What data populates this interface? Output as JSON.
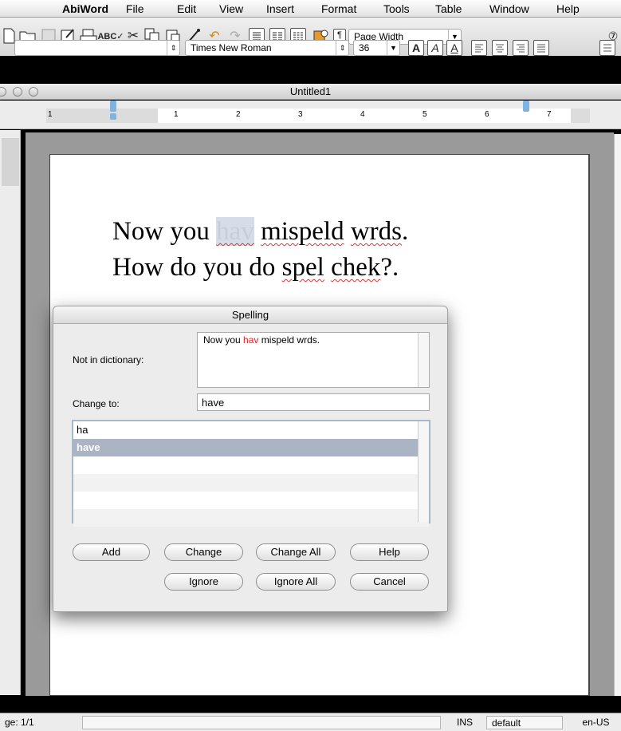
{
  "menubar": {
    "app": "AbiWord",
    "items": [
      "File",
      "Edit",
      "View",
      "Insert",
      "Format",
      "Tools",
      "Table",
      "Window",
      "Help"
    ]
  },
  "toolbar": {
    "zoom": "Page Width",
    "style_value": "",
    "font": "Times New Roman",
    "size": "36"
  },
  "window": {
    "title": "Untitled1"
  },
  "ruler": {
    "numbers": [
      "1",
      "1",
      "2",
      "3",
      "4",
      "5",
      "6",
      "7"
    ]
  },
  "document": {
    "line1": {
      "w1": "Now you ",
      "w2": "hav",
      "w3": " ",
      "w4": "mispeld",
      "w5": " ",
      "w6": "wrds",
      "w7": "."
    },
    "line2": {
      "w1": "How do you do ",
      "w2": "spel",
      "w3": " ",
      "w4": "chek",
      "w5": "?."
    }
  },
  "dialog": {
    "title": "Spelling",
    "not_in_dict_label": "Not in dictionary:",
    "context": {
      "before": "Now you ",
      "word": "hav",
      "after": " mispeld wrds."
    },
    "change_to_label": "Change to:",
    "change_to_value": "have",
    "suggestions": [
      "ha",
      "have"
    ],
    "buttons": {
      "add": "Add",
      "change": "Change",
      "change_all": "Change All",
      "help": "Help",
      "ignore": "Ignore",
      "ignore_all": "Ignore All",
      "cancel": "Cancel"
    }
  },
  "status": {
    "page": "ge: 1/1",
    "mode": "INS",
    "style": "default",
    "lang": "en-US"
  },
  "colors": {
    "misspell": "#d33",
    "selection": "#aab4c4"
  }
}
